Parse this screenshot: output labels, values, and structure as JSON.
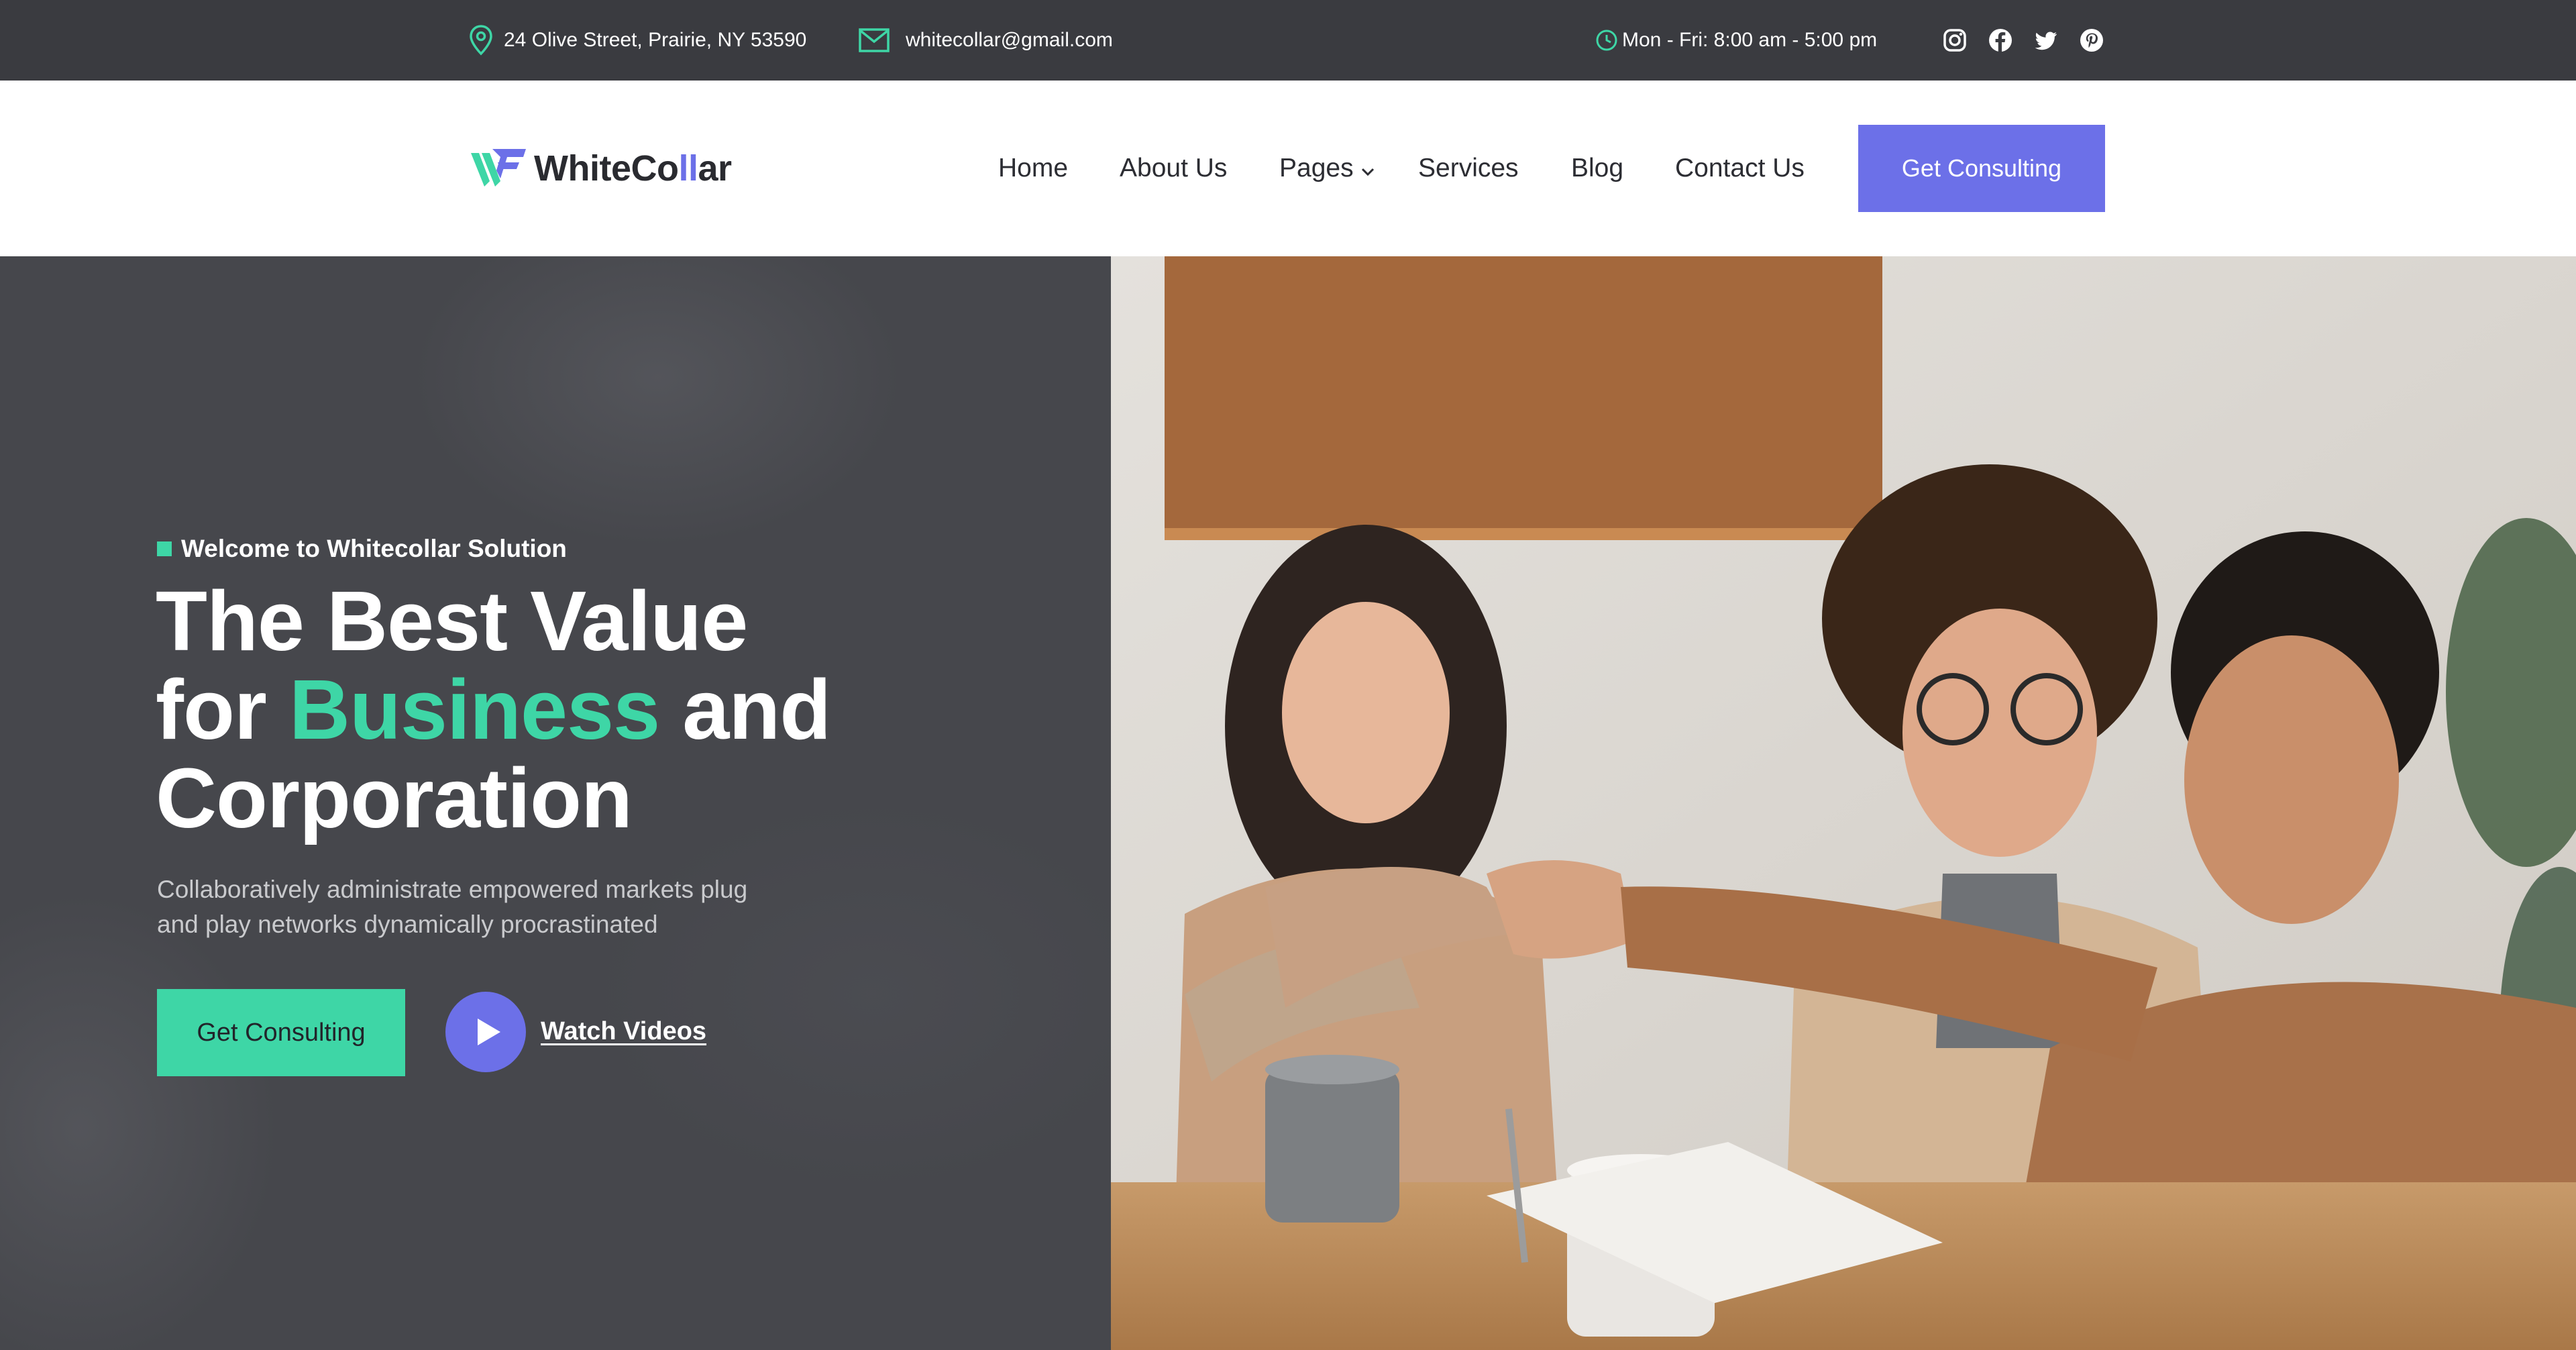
{
  "topbar": {
    "address": "24 Olive Street, Prairie, NY 53590",
    "email": "whitecollar@gmail.com",
    "hours": "Mon - Fri: 8:00 am - 5:00 pm",
    "icons": {
      "address": "location-pin-icon",
      "email": "envelope-icon",
      "hours": "clock-icon"
    },
    "social": [
      "instagram-icon",
      "facebook-icon",
      "twitter-icon",
      "pinterest-icon"
    ]
  },
  "header": {
    "logo": {
      "part1": "WhiteCo",
      "accent": "ll",
      "part2": "ar"
    },
    "nav": {
      "home": "Home",
      "about": "About Us",
      "pages": "Pages",
      "services": "Services",
      "blog": "Blog",
      "contact": "Contact Us"
    },
    "cta": "Get Consulting"
  },
  "hero": {
    "eyebrow": "Welcome to Whitecollar Solution",
    "headline": {
      "line1": "The Best Value",
      "line2_before": "for ",
      "line2_highlight": "Business",
      "line2_after": " and",
      "line3": "Corporation"
    },
    "subtitle_line1": "Collaboratively administrate empowered markets plug",
    "subtitle_line2": "and play networks dynamically procrastinated",
    "cta": "Get Consulting",
    "video_link": "Watch Videos"
  },
  "colors": {
    "topbar_bg": "#3a3b40",
    "accent_purple": "#6c70e8",
    "accent_green": "#3ed6a6",
    "hero_dark": "#46474c"
  }
}
